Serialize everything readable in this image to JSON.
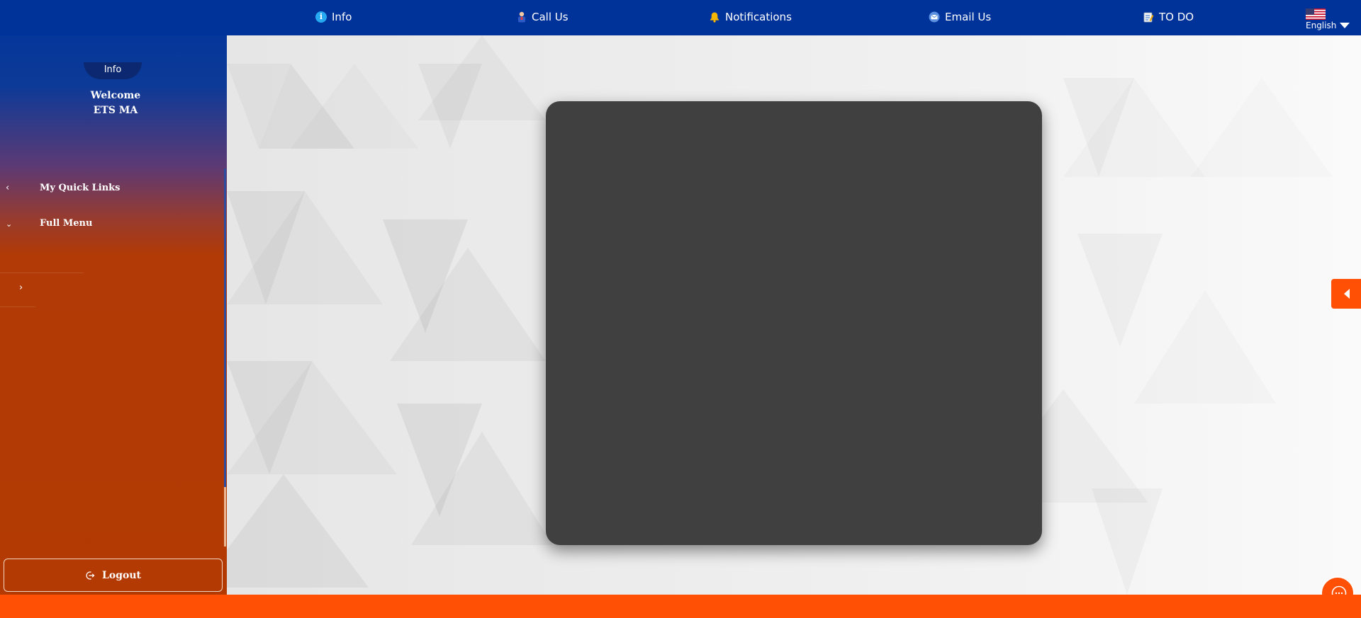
{
  "topbar": {
    "nav": [
      {
        "label": "Info",
        "icon": "info-icon"
      },
      {
        "label": "Call Us",
        "icon": "call-icon"
      },
      {
        "label": "Notifications",
        "icon": "bell-icon"
      },
      {
        "label": "Email Us",
        "icon": "email-icon"
      },
      {
        "label": "TO DO",
        "icon": "todo-icon"
      }
    ],
    "language": {
      "label": "English",
      "icon": "us-flag-icon"
    }
  },
  "sidebar": {
    "info_tab": "Info",
    "welcome_line1": "Welcome",
    "welcome_line2": "ETS MA",
    "links": [
      {
        "label": "My Quick Links",
        "icon": "chevron-left-icon"
      },
      {
        "label": "Full Menu",
        "icon": "chevron-down-icon"
      }
    ],
    "sub_chevron": "chevron-right-icon",
    "logout_label": "Logout"
  },
  "colors": {
    "topbar": "#00339a",
    "accent": "#ff5005",
    "sidebar_bottom": "#b33a02",
    "video_box": "#404040"
  }
}
